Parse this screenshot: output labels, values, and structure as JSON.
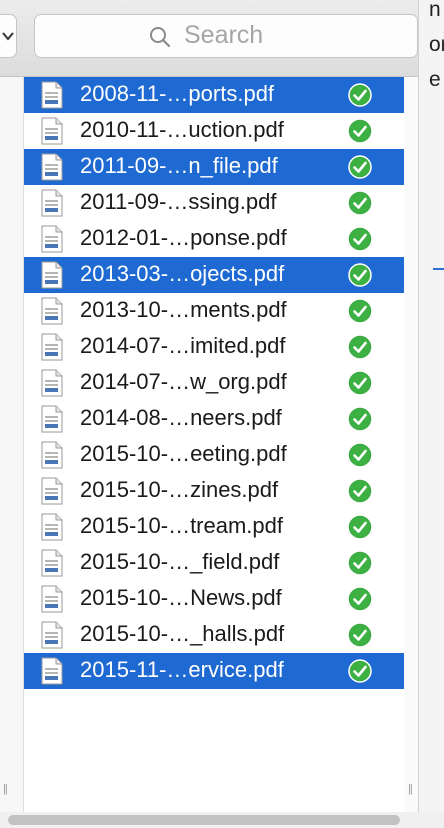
{
  "search": {
    "placeholder": "Search"
  },
  "right_pane_fragments": [
    "n",
    "or",
    "e"
  ],
  "files": [
    {
      "name": "2008-11-…ports.pdf",
      "selected": true,
      "synced": true
    },
    {
      "name": "2010-11-…uction.pdf",
      "selected": false,
      "synced": true
    },
    {
      "name": "2011-09-…n_file.pdf",
      "selected": true,
      "synced": true
    },
    {
      "name": "2011-09-…ssing.pdf",
      "selected": false,
      "synced": true
    },
    {
      "name": "2012-01-…ponse.pdf",
      "selected": false,
      "synced": true
    },
    {
      "name": "2013-03-…ojects.pdf",
      "selected": true,
      "synced": true
    },
    {
      "name": "2013-10-…ments.pdf",
      "selected": false,
      "synced": true
    },
    {
      "name": "2014-07-…imited.pdf",
      "selected": false,
      "synced": true
    },
    {
      "name": "2014-07-…w_org.pdf",
      "selected": false,
      "synced": true
    },
    {
      "name": "2014-08-…neers.pdf",
      "selected": false,
      "synced": true
    },
    {
      "name": "2015-10-…eeting.pdf",
      "selected": false,
      "synced": true
    },
    {
      "name": "2015-10-…zines.pdf",
      "selected": false,
      "synced": true
    },
    {
      "name": "2015-10-…tream.pdf",
      "selected": false,
      "synced": true
    },
    {
      "name": "2015-10-…_field.pdf",
      "selected": false,
      "synced": true
    },
    {
      "name": "2015-10-…News.pdf",
      "selected": false,
      "synced": true
    },
    {
      "name": "2015-10-…_halls.pdf",
      "selected": false,
      "synced": true
    },
    {
      "name": "2015-11-…ervice.pdf",
      "selected": true,
      "synced": true
    }
  ],
  "icons": {
    "file": "pdf-document-icon",
    "status": "checkmark-circle-icon",
    "search": "magnifier-icon",
    "chevron": "chevron-down-icon",
    "grip": "column-resize-grip-icon"
  },
  "colors": {
    "selection": "#1e6ad2",
    "check": "#3cb043",
    "toolbar": "#e2e2e2"
  }
}
